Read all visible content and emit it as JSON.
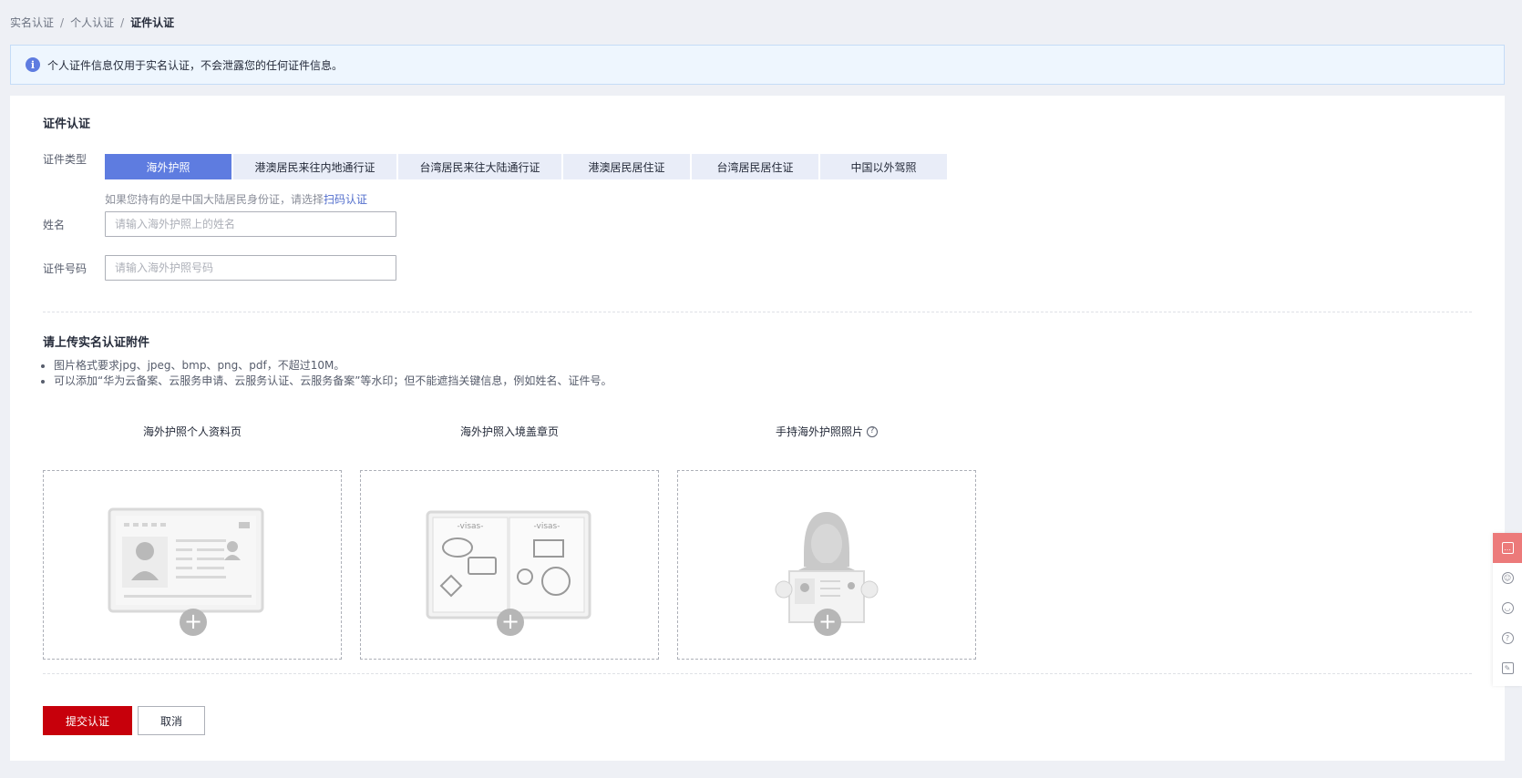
{
  "breadcrumb": {
    "items": [
      "实名认证",
      "个人认证"
    ],
    "current": "证件认证",
    "separator": "/"
  },
  "notice": {
    "icon": "info-icon",
    "text": "个人证件信息仅用于实名认证，不会泄露您的任何证件信息。"
  },
  "form": {
    "section_title": "证件认证",
    "type_label": "证件类型",
    "tabs": [
      {
        "label": "海外护照",
        "active": true
      },
      {
        "label": "港澳居民来往内地通行证",
        "active": false
      },
      {
        "label": "台湾居民来往大陆通行证",
        "active": false
      },
      {
        "label": "港澳居民居住证",
        "active": false
      },
      {
        "label": "台湾居民居住证",
        "active": false
      },
      {
        "label": "中国以外驾照",
        "active": false
      }
    ],
    "hint_prefix": "如果您持有的是中国大陆居民身份证，请选择",
    "hint_link": "扫码认证",
    "name_label": "姓名",
    "name_placeholder": "请输入海外护照上的姓名",
    "name_value": "",
    "id_label": "证件号码",
    "id_placeholder": "请输入海外护照号码",
    "id_value": ""
  },
  "upload": {
    "section_title": "请上传实名认证附件",
    "requirements": [
      "图片格式要求jpg、jpeg、bmp、png、pdf，不超过10M。",
      "可以添加“华为云备案、云服务申请、云服务认证、云服务备案”等水印；但不能遮挡关键信息，例如姓名、证件号。"
    ],
    "items": [
      {
        "label": "海外护照个人资料页",
        "help": false,
        "illustration": "passport-info-page"
      },
      {
        "label": "海外护照入境盖章页",
        "help": true,
        "illustration": "visa-stamp-page",
        "stamp_text_left": "-visas-",
        "stamp_text_right": "-visas-"
      },
      {
        "label": "手持海外护照照片",
        "help": true,
        "illustration": "holding-passport"
      }
    ],
    "plus": "+",
    "help_mark": "?"
  },
  "actions": {
    "submit": "提交认证",
    "cancel": "取消"
  },
  "float_bar": {
    "items": [
      "message-icon",
      "robot-icon",
      "headset-icon",
      "help-icon",
      "feedback-icon"
    ]
  },
  "colors": {
    "accent": "#5e7ce0",
    "primary_button": "#c7000b",
    "notice_bg": "#eef6fe",
    "float_hot": "#ec7a7a"
  }
}
